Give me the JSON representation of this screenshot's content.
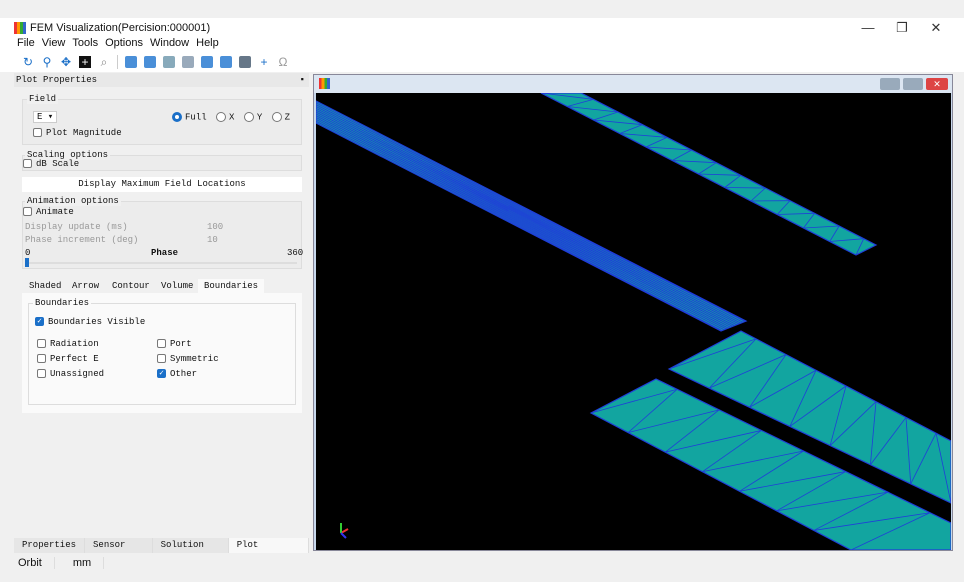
{
  "window": {
    "title": "FEM Visualization(Percision:000001)",
    "minimize": "—",
    "restore": "❐",
    "close": "✕"
  },
  "menu": [
    "File",
    "View",
    "Tools",
    "Options",
    "Window",
    "Help"
  ],
  "panel": {
    "title": "Plot Properties",
    "field": {
      "label": "Field",
      "select_value": "E",
      "options": [
        "Full",
        "X",
        "Y",
        "Z"
      ],
      "selected": "Full",
      "plot_magnitude": "Plot Magnitude"
    },
    "scaling": {
      "label": "Scaling options",
      "db_scale": "dB Scale"
    },
    "display_max_button": "Display Maximum Field Locations",
    "animation": {
      "label": "Animation options",
      "animate": "Animate",
      "display_update_label": "Display update (ms)",
      "display_update_value": "100",
      "phase_increment_label": "Phase increment (deg)",
      "phase_increment_value": "10",
      "phase_label": "Phase",
      "phase_min": "0",
      "phase_max": "360",
      "phase_value": 0
    },
    "tabs": [
      "Shaded",
      "Arrow",
      "Contour",
      "Volume",
      "Boundaries"
    ],
    "active_tab": "Boundaries",
    "boundaries": {
      "label": "Boundaries",
      "visible": "Boundaries Visible",
      "items": [
        {
          "label": "Radiation",
          "checked": false
        },
        {
          "label": "Port",
          "checked": false
        },
        {
          "label": "Perfect E",
          "checked": false
        },
        {
          "label": "Symmetric",
          "checked": false
        },
        {
          "label": "Unassigned",
          "checked": false
        },
        {
          "label": "Other",
          "checked": true
        }
      ]
    }
  },
  "bottom_tabs": [
    "Properties",
    "Sensor Setup",
    "Solution Setup",
    "Plot Properties"
  ],
  "status": {
    "mode": "Orbit",
    "units": "mm"
  },
  "colors": {
    "mesh_fill": "#12a5a0",
    "mesh_line": "#1f3fd8",
    "accent": "#1a6fc8"
  }
}
